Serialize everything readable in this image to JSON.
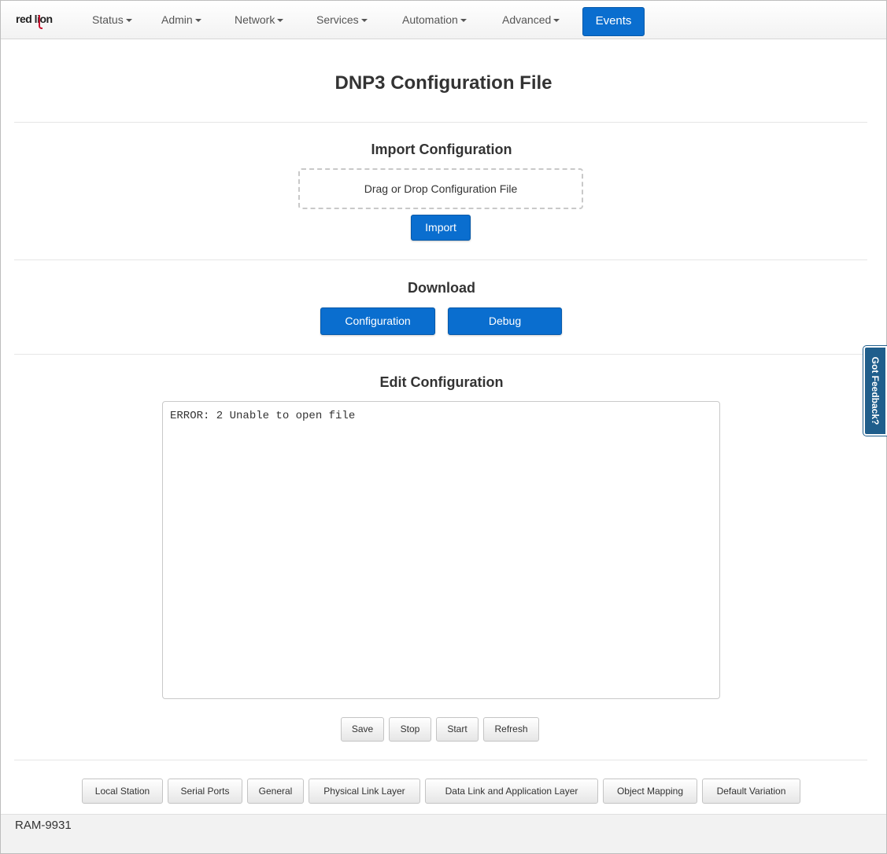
{
  "brand": {
    "logo_text": "red lion"
  },
  "nav": {
    "items": [
      "Status",
      "Admin",
      "Network",
      "Services",
      "Automation",
      "Advanced"
    ],
    "events_label": "Events"
  },
  "page": {
    "title": "DNP3 Configuration File"
  },
  "import_section": {
    "heading": "Import Configuration",
    "dropzone_text": "Drag or Drop Configuration File",
    "import_button": "Import"
  },
  "download_section": {
    "heading": "Download",
    "configuration_button": "Configuration",
    "debug_button": "Debug"
  },
  "edit_section": {
    "heading": "Edit Configuration",
    "editor_content": "ERROR: 2 Unable to open file",
    "buttons": [
      "Save",
      "Stop",
      "Start",
      "Refresh"
    ]
  },
  "config_tabs": [
    "Local Station",
    "Serial Ports",
    "General",
    "Physical Link Layer",
    "Data Link and Application Layer",
    "Object Mapping",
    "Default Variation"
  ],
  "footer": {
    "device_name": "RAM-9931"
  },
  "feedback": {
    "label": "Got Feedback?"
  },
  "colors": {
    "primary_button": "#0a6ecf",
    "feedback_tab": "#1f5e8c",
    "logo_accent": "#c8102e"
  }
}
